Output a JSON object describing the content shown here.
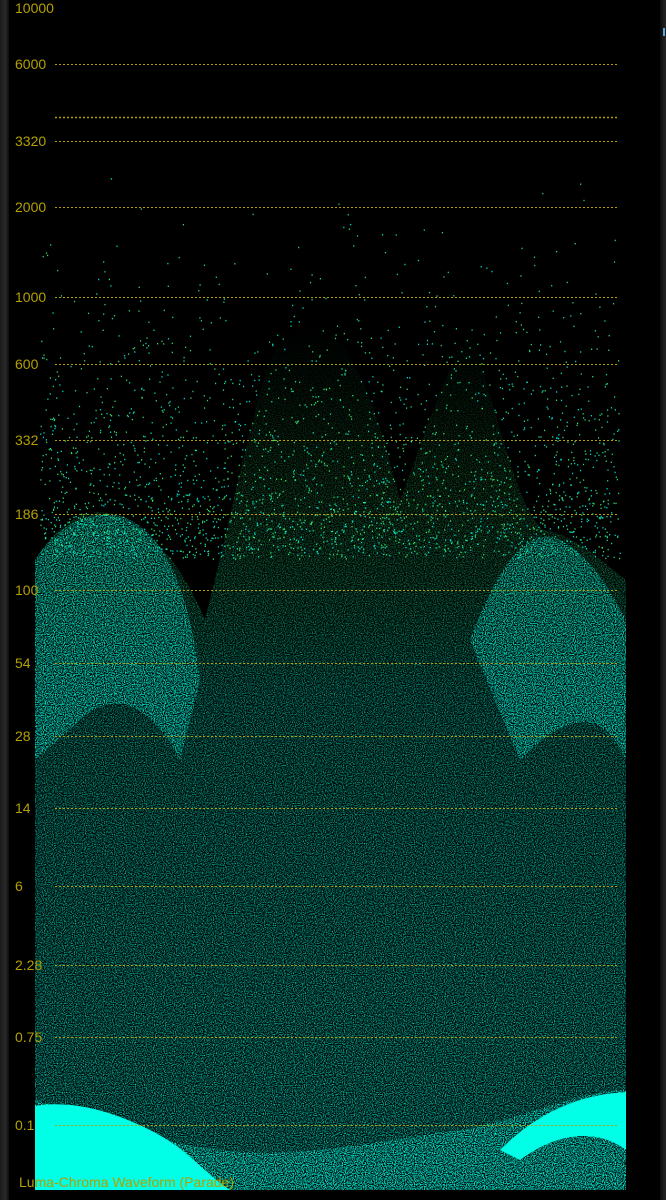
{
  "scope": {
    "caption": "Luma-Chroma Waveform (Parade)",
    "trace_color": "#00ffe6",
    "trace_speckle_color": "#3cff78",
    "grid_color": "#b4a000",
    "background": "#000000",
    "ticks": [
      {
        "label": "10000",
        "value": 10000
      },
      {
        "label": "6000",
        "value": 6000
      },
      {
        "label": "",
        "value": 4500
      },
      {
        "label": "3320",
        "value": 3320
      },
      {
        "label": "2000",
        "value": 2000
      },
      {
        "label": "1000",
        "value": 1000
      },
      {
        "label": "600",
        "value": 600
      },
      {
        "label": "332",
        "value": 332
      },
      {
        "label": "186",
        "value": 186
      },
      {
        "label": "100",
        "value": 100
      },
      {
        "label": "54",
        "value": 54
      },
      {
        "label": "28",
        "value": 28
      },
      {
        "label": "14",
        "value": 14
      },
      {
        "label": "6",
        "value": 6
      },
      {
        "label": "2.28",
        "value": 2.28
      },
      {
        "label": "0.75",
        "value": 0.75
      },
      {
        "label": "0.1",
        "value": 0.1
      }
    ]
  }
}
